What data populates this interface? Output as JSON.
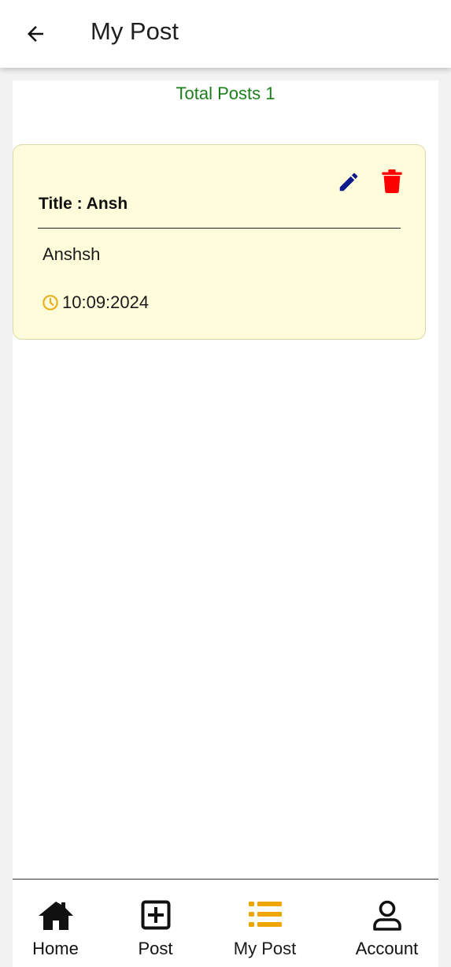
{
  "appbar": {
    "title": "My Post",
    "back_icon": "arrow-left-icon"
  },
  "summary": {
    "total_posts_text": "Total Posts 1"
  },
  "posts": [
    {
      "title_label": "Title : Ansh",
      "body": "Anshsh",
      "date": "10:09:2024",
      "edit_icon": "pencil-icon",
      "delete_icon": "trash-icon",
      "clock_icon": "clock-icon"
    }
  ],
  "bottom_nav": {
    "items": [
      {
        "label": "Home",
        "icon": "home-icon",
        "active": false
      },
      {
        "label": "Post",
        "icon": "plus-square-icon",
        "active": false
      },
      {
        "label": "My Post",
        "icon": "list-icon",
        "active": true
      },
      {
        "label": "Account",
        "icon": "user-icon",
        "active": false
      }
    ]
  },
  "colors": {
    "accent_green": "#1a7f1a",
    "card_background": "#fffcdc",
    "edit_icon": "#0d1a8c",
    "delete_icon": "#ff0000",
    "active_nav": "#f0a400",
    "clock_icon": "#e8b020"
  }
}
